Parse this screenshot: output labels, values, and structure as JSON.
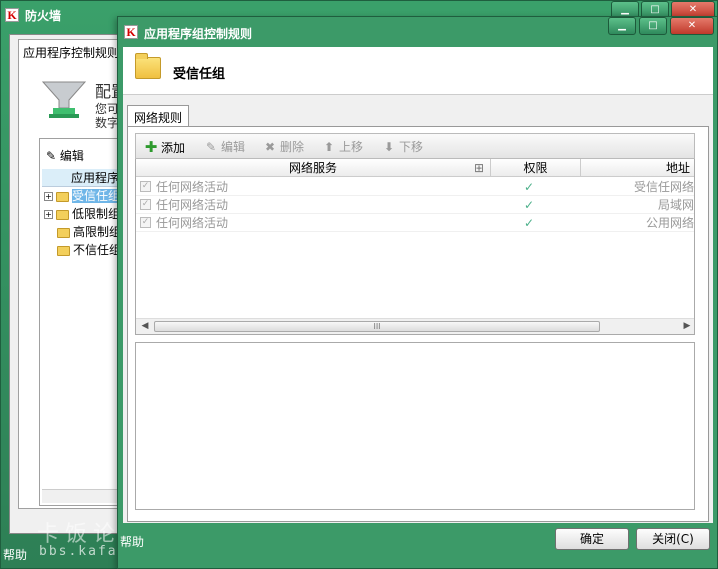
{
  "background_window": {
    "title": "防火墙",
    "panel_title": "应用程序控制规则",
    "config_heading": "配置",
    "desc_line1": "您可以",
    "desc_line2": "数字签",
    "edit_label": "编辑",
    "tree_header": "应用程序",
    "tree_items": [
      {
        "label": "受信任组",
        "expander": "+",
        "selected": true
      },
      {
        "label": "低限制组",
        "expander": "+",
        "selected": false
      },
      {
        "label": "高限制组",
        "expander": "",
        "selected": false
      },
      {
        "label": "不信任组",
        "expander": "",
        "selected": false
      }
    ],
    "help_label": "帮助",
    "watermark": "卡饭论坛",
    "watermark_url": "bbs.kafan.cn"
  },
  "dialog": {
    "title": "应用程序组控制规则",
    "header_title": "受信任组",
    "tab_label": "网络规则",
    "toolbar": {
      "add": "添加",
      "edit": "编辑",
      "delete": "删除",
      "move_up": "上移",
      "move_down": "下移"
    },
    "grid": {
      "columns": [
        "网络服务",
        "权限",
        "地址"
      ],
      "rows": [
        {
          "service": "任何网络活动",
          "permission": "✓",
          "address": "受信任网络"
        },
        {
          "service": "任何网络活动",
          "permission": "✓",
          "address": "局域网"
        },
        {
          "service": "任何网络活动",
          "permission": "✓",
          "address": "公用网络"
        }
      ],
      "scroll_grip": "III"
    },
    "help_label": "帮助",
    "ok_label": "确定",
    "close_label": "关闭(C)"
  },
  "colors": {
    "frame_green": "#3c9a68",
    "check_teal": "#4cb08a"
  }
}
